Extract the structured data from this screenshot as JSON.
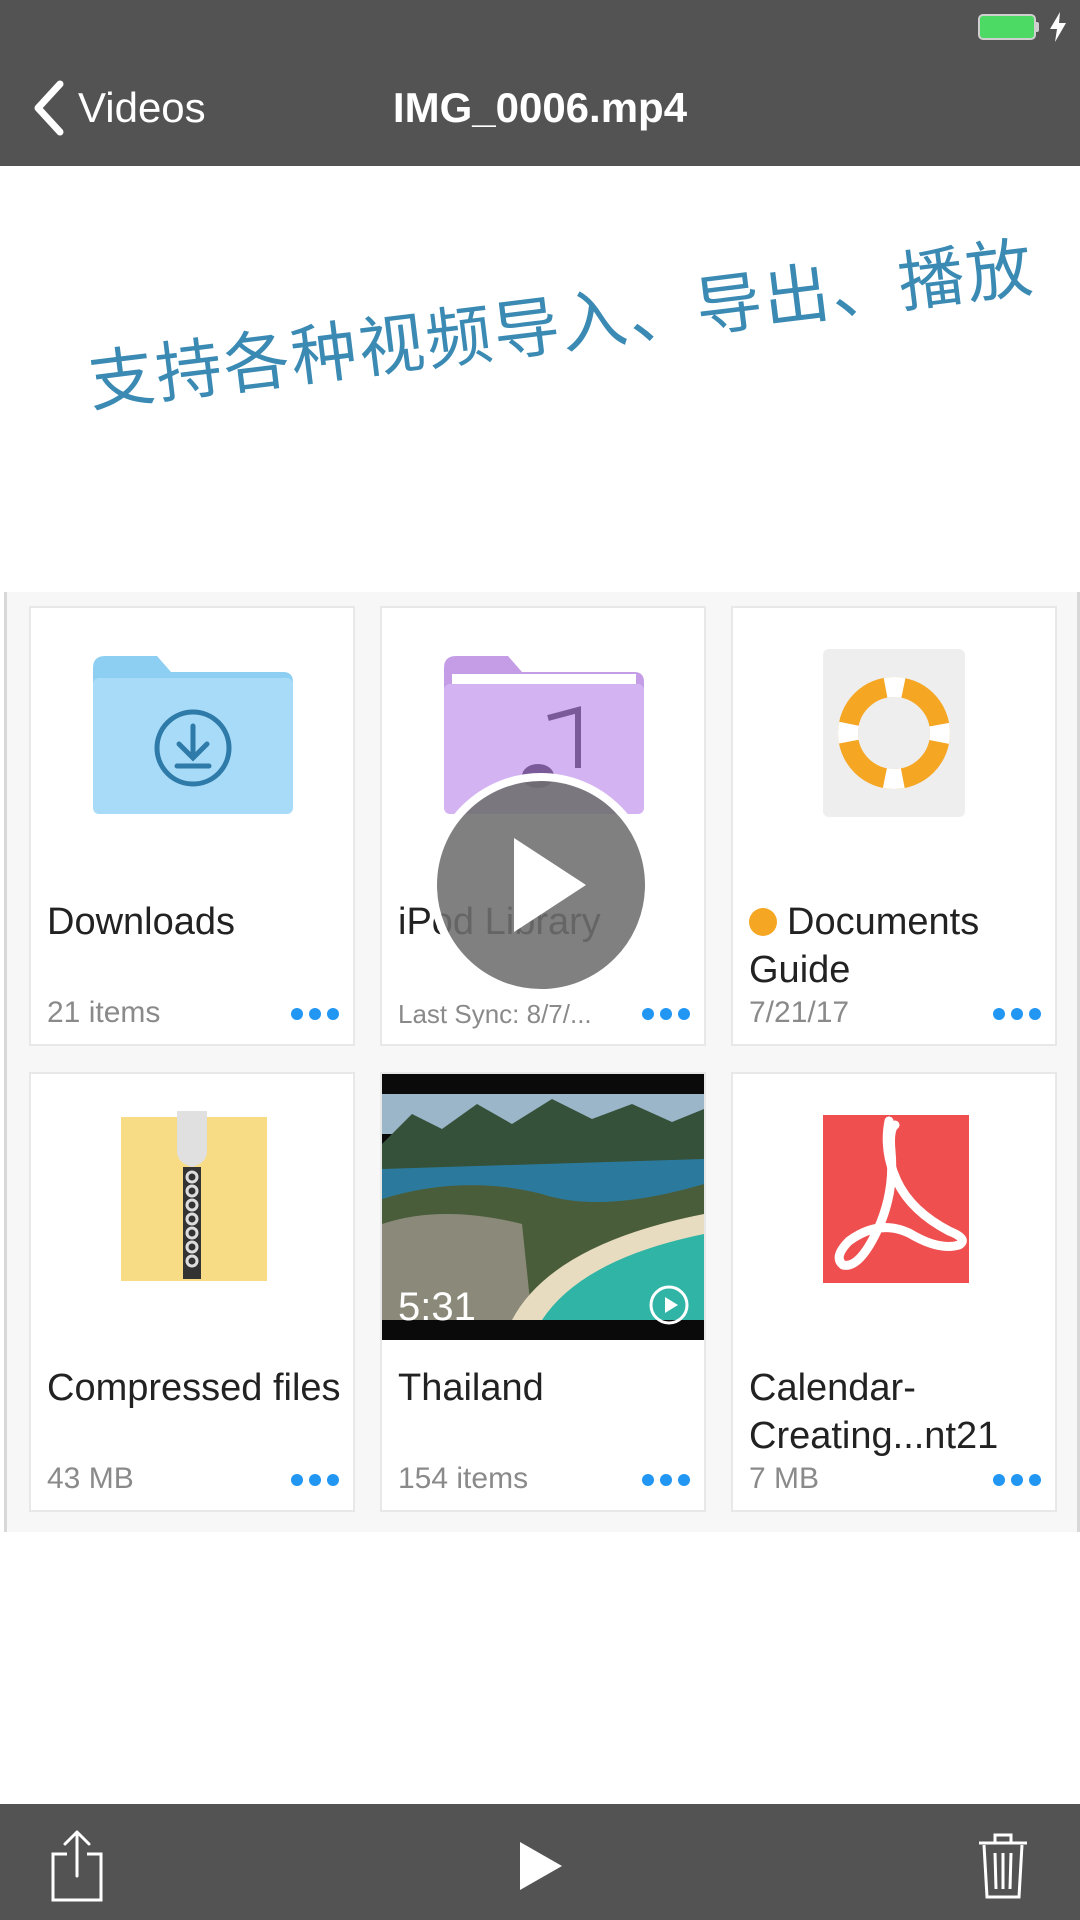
{
  "nav": {
    "back_label": "Videos",
    "title": "IMG_0006.mp4"
  },
  "promo": {
    "caption": "支持各种视频导入、导出、播放"
  },
  "files": [
    {
      "name": "Downloads",
      "subtitle": "21 items",
      "icon": "downloads-folder-icon"
    },
    {
      "name": "iPod Library",
      "subtitle": "Last Sync: 8/7/...",
      "icon": "music-folder-icon"
    },
    {
      "name": "Documents Guide",
      "subtitle": "7/21/17",
      "icon": "lifebuoy-icon",
      "tag_color": "#f5a623"
    },
    {
      "name": "Compressed files",
      "subtitle": "43 MB",
      "icon": "zip-archive-icon"
    },
    {
      "name": "Thailand",
      "subtitle": "154 items",
      "icon": "video-thumbnail",
      "duration": "5:31"
    },
    {
      "name": "Calendar-Creating...nt21",
      "subtitle": "7 MB",
      "icon": "pdf-icon"
    }
  ],
  "toolbar": {
    "share_icon": "share-icon",
    "play_icon": "play-icon",
    "delete_icon": "trash-icon"
  },
  "colors": {
    "bar": "#535353",
    "caption": "#3a8ab3",
    "accent": "#2196f3",
    "battery": "#4cd964"
  }
}
